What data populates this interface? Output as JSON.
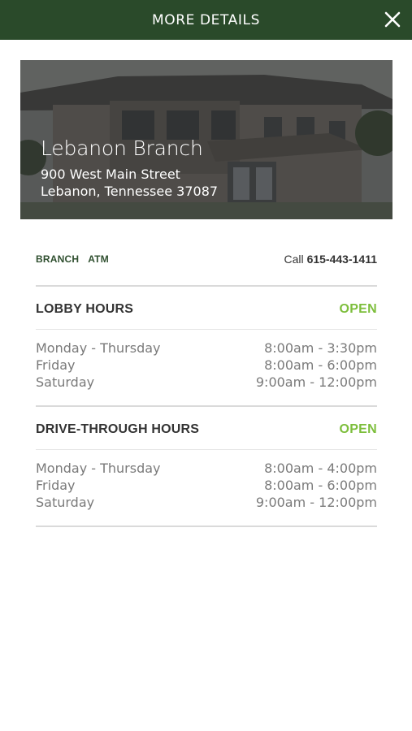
{
  "header": {
    "title": "MORE DETAILS"
  },
  "branch": {
    "name": "Lebanon Branch",
    "address_line1": "900 West Main Street",
    "address_line2": "Lebanon, Tennessee 37087"
  },
  "tabs": {
    "branch_label": "BRANCH",
    "atm_label": "ATM"
  },
  "call": {
    "label": "Call",
    "number": "615-443-1411"
  },
  "lobby": {
    "title": "LOBBY HOURS",
    "status": "OPEN",
    "rows": [
      {
        "day": "Monday - Thursday",
        "time": "8:00am - 3:30pm"
      },
      {
        "day": "Friday",
        "time": "8:00am - 6:00pm"
      },
      {
        "day": "Saturday",
        "time": "9:00am - 12:00pm"
      }
    ]
  },
  "drive_through": {
    "title": "DRIVE-THROUGH HOURS",
    "status": "OPEN",
    "rows": [
      {
        "day": "Monday - Thursday",
        "time": "8:00am - 4:00pm"
      },
      {
        "day": "Friday",
        "time": "8:00am - 6:00pm"
      },
      {
        "day": "Saturday",
        "time": "9:00am - 12:00pm"
      }
    ]
  },
  "colors": {
    "header_bg": "#2a4a2a",
    "status_open": "#7dbe3c",
    "tab_text": "#2f4f2f"
  }
}
